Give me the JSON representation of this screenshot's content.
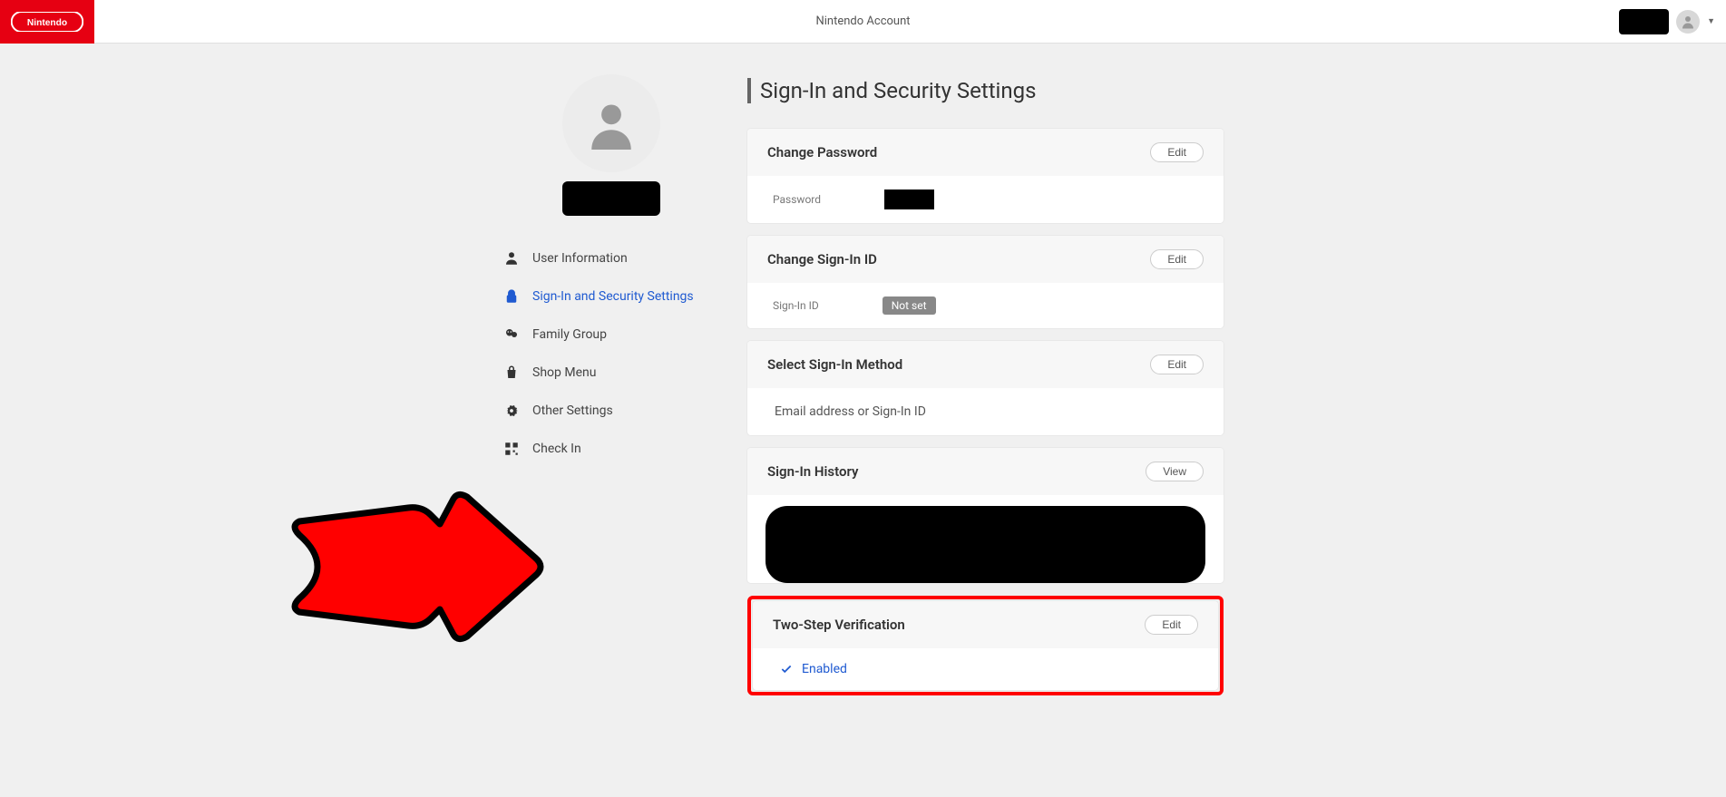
{
  "header": {
    "title": "Nintendo Account"
  },
  "sidebar": {
    "items": [
      {
        "label": "User Information"
      },
      {
        "label": "Sign-In and Security Settings"
      },
      {
        "label": "Family Group"
      },
      {
        "label": "Shop Menu"
      },
      {
        "label": "Other Settings"
      },
      {
        "label": "Check In"
      }
    ]
  },
  "pageTitle": "Sign-In and Security Settings",
  "cards": {
    "password": {
      "title": "Change Password",
      "action": "Edit",
      "fieldLabel": "Password"
    },
    "signInId": {
      "title": "Change Sign-In ID",
      "action": "Edit",
      "fieldLabel": "Sign-In ID",
      "value": "Not set"
    },
    "signInMethod": {
      "title": "Select Sign-In Method",
      "action": "Edit",
      "value": "Email address or Sign-In ID"
    },
    "history": {
      "title": "Sign-In History",
      "action": "View"
    },
    "twoStep": {
      "title": "Two-Step Verification",
      "action": "Edit",
      "status": "Enabled"
    }
  }
}
